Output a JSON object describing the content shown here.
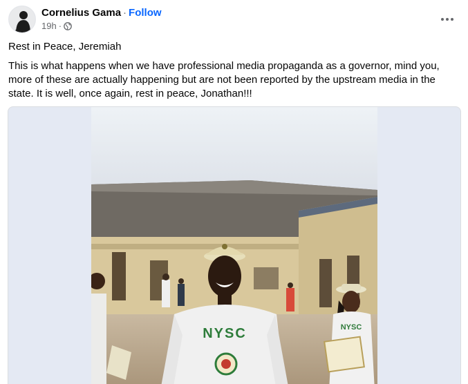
{
  "post": {
    "author": "Cornelius Gama",
    "separator": "·",
    "follow_label": "Follow",
    "timestamp": "19h",
    "meta_separator": "·",
    "audience_icon": "globe-icon",
    "more_icon": "more-options-icon",
    "title_line": "Rest in Peace, Jeremiah",
    "body": "This is what happens when we have professional media propaganda as a governor, mind you, more of these are actually happening but are not been reported by the upstream media in the state. It is well, once again, rest in peace, Jonathan!!!",
    "photo": {
      "shirt_text_main": "NYSC",
      "shirt_text_side": "NYSC"
    }
  },
  "colors": {
    "link": "#0866ff",
    "secondary_text": "#65676b",
    "media_background": "#e4e9f3"
  }
}
